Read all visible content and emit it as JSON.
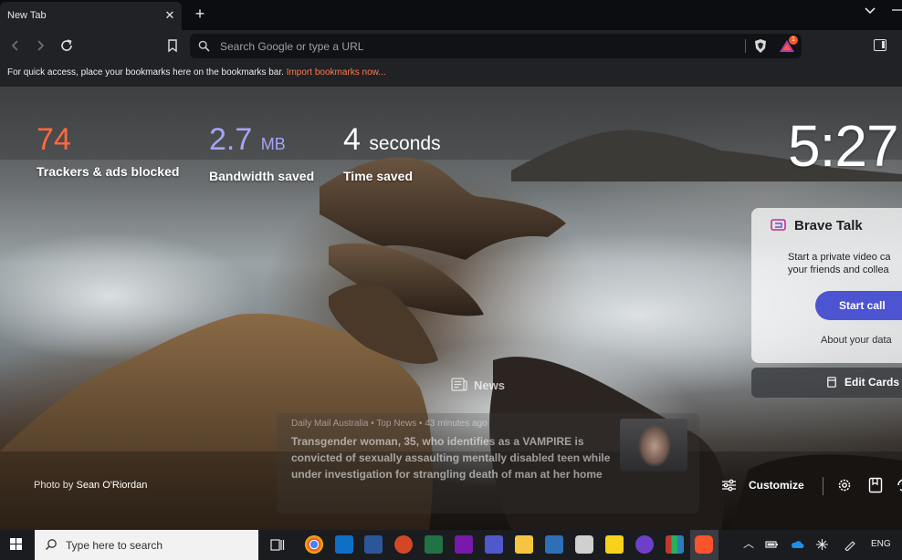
{
  "browser": {
    "tab_title": "New Tab",
    "tab_close": "✕",
    "new_tab": "+",
    "omnibox_placeholder": "Search Google or type a URL",
    "rewards_badge": "1",
    "bookmarks_bar_text": "For quick access, place your bookmarks here on the bookmarks bar.",
    "bookmarks_bar_link": "Import bookmarks now..."
  },
  "stats": {
    "trackers_value": "74",
    "trackers_label": "Trackers & ads blocked",
    "bandwidth_value": "2.7",
    "bandwidth_unit": "MB",
    "bandwidth_label": "Bandwidth saved",
    "time_value": "4",
    "time_unit": "seconds",
    "time_label": "Time saved"
  },
  "clock": "5:27",
  "brave_talk": {
    "title": "Brave Talk",
    "description_line1": "Start a private video ca",
    "description_line2": "your friends and collea",
    "start_button": "Start call",
    "about_link": "About your data"
  },
  "edit_cards": "Edit Cards",
  "news": {
    "label": "News",
    "meta": "Daily Mail Australia  •  Top News  •  43 minutes ago",
    "headline": "Transgender woman, 35, who identifies as a VAMPIRE is convicted of sexually assaulting mentally disabled teen while under investigation for strangling death of man at her home"
  },
  "photo_credit": {
    "prefix": "Photo by",
    "author": "Sean O'Riordan"
  },
  "customize": "Customize",
  "taskbar": {
    "search_placeholder": "Type here to search",
    "language": "ENG",
    "apps": [
      "chrome",
      "mail",
      "word",
      "powerpoint",
      "excel",
      "onenote",
      "teams",
      "file-explorer",
      "virtualbox",
      "unity",
      "sticky-notes",
      "github",
      "winrar",
      "brave"
    ]
  },
  "colors": {
    "trackers": "#ff6a3d",
    "bandwidth": "#a7a4f7",
    "talk_button": "#4c54d2",
    "import_link": "#ff7b4d"
  }
}
